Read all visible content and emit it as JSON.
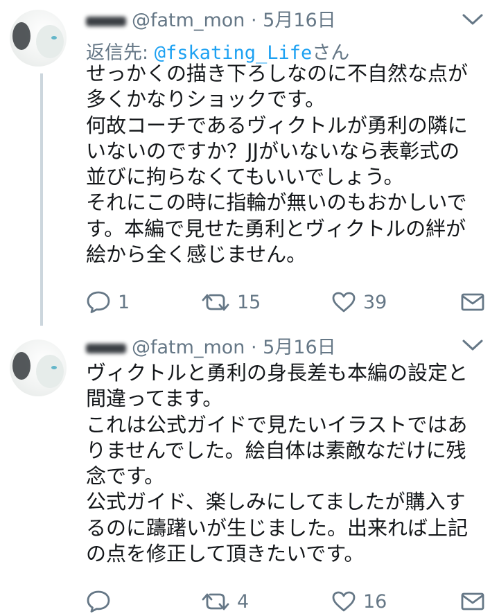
{
  "tweets": [
    {
      "handle": "@fatm_mon",
      "date": "5月16日",
      "replying_prefix": "返信先:",
      "replying_handle": "@fskating_Life",
      "replying_suffix": "さん",
      "lines": [
        "せっかくの描き下ろしなのに不自然な点が",
        "多くかなりショックです。",
        "何故コーチであるヴィクトルが勇利の隣に",
        "いないのですか？JJがいないなら表彰式の",
        "並びに拘らなくてもいいでしょう。",
        "それにこの時に指輪が無いのもおかしいで",
        "す。本編で見せた勇利とヴィクトルの絆が",
        "絵から全く感じません。"
      ],
      "replies": "1",
      "retweets": "15",
      "likes": "39"
    },
    {
      "handle": "@fatm_mon",
      "date": "5月16日",
      "lines": [
        "ヴィクトルと勇利の身長差も本編の設定と",
        "間違ってます。",
        "これは公式ガイドで見たいイラストではあ",
        "りませんでした。絵自体は素敵なだけに残",
        "念です。",
        "公式ガイド、楽しみにしてましたが購入す",
        "るのに躊躇いが生じました。出来れば上記",
        "の点を修正して頂きたいです。"
      ],
      "replies": "",
      "retweets": "4",
      "likes": "16"
    }
  ],
  "colors": {
    "text": "#14171a",
    "secondary": "#657786",
    "mention": "#1da1f2",
    "thread_line": "#ccd6dd"
  },
  "icons": {
    "reply": "reply-icon",
    "retweet": "retweet-icon",
    "like": "heart-icon",
    "dm": "envelope-icon",
    "menu": "chevron-down-icon"
  }
}
